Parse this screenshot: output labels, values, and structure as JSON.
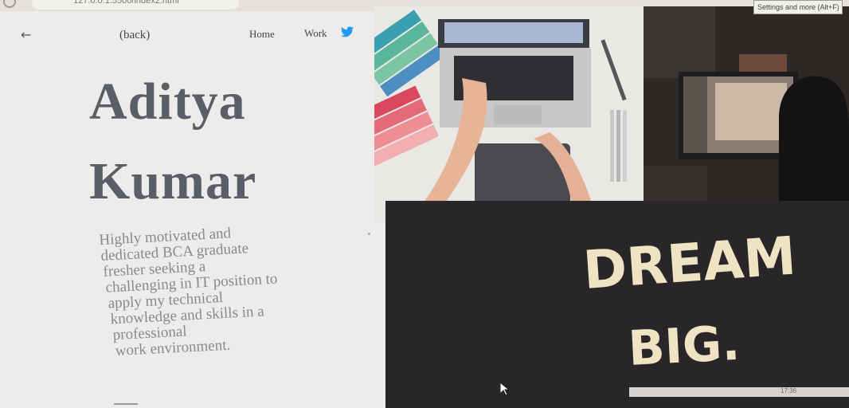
{
  "browser": {
    "url": "127.0.0.1:5500/index2.html",
    "settings_tooltip": "Settings and more (Alt+F)",
    "clock": "17:36"
  },
  "nav": {
    "back_label": "(back)",
    "home_label": "Home",
    "work_label": "Work",
    "twitter_icon": "twitter-icon"
  },
  "hero": {
    "first_name": "Aditya",
    "last_name": "Kumar",
    "bio_lines": [
      "Highly motivated and",
      "dedicated BCA graduate",
      "fresher seeking a",
      "challenging in IT position to",
      "apply my technical",
      "knowledge and skills in a",
      "professional",
      "work environment."
    ]
  },
  "imagery": {
    "chalkboard_line_1": "DREAM",
    "chalkboard_line_2": "BIG."
  },
  "colors": {
    "page_bg": "#edecea",
    "name_text": "#5a5e68",
    "bio_text": "#8a8a8a",
    "twitter_blue": "#1d9bf0",
    "chalkboard": "#262425"
  }
}
